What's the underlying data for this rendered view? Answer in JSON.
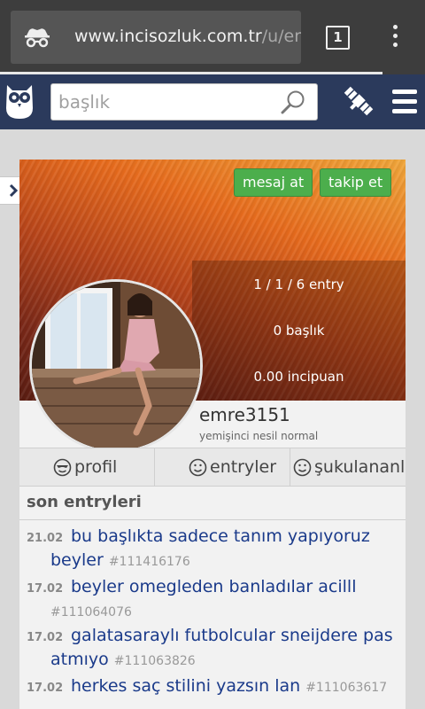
{
  "browser": {
    "url_host": "www.incisozluk.com.tr",
    "url_path": "/u/er",
    "tab_count": "1"
  },
  "header": {
    "search_placeholder": "başlık"
  },
  "profile": {
    "message_button": "mesaj at",
    "follow_button": "takip et",
    "stats": {
      "entries": "1 / 1 / 6 entry",
      "titles": "0 başlık",
      "points": "0.00 incipuan"
    },
    "username": "emre3151",
    "user_type": "yemişinci nesil normal",
    "tabs": [
      "profil",
      "entryler",
      "şukulananlar"
    ]
  },
  "recent_entries": {
    "title": "son entryleri",
    "items": [
      {
        "date": "21.02",
        "text": "bu başlıkta sadece tanım yapıyoruz beyler",
        "id": "#111416176"
      },
      {
        "date": "17.02",
        "text": "beyler omegleden banladılar acilll",
        "id": "#111064076"
      },
      {
        "date": "17.02",
        "text": "galatasaraylı futbolcular sneijdere pas atmıyo",
        "id": "#111063826"
      },
      {
        "date": "17.02",
        "text": "herkes saç stilini yazsın lan",
        "id": "#111063617"
      }
    ]
  },
  "colors": {
    "header_bg": "#2b3a5c",
    "button_green": "#4cae4c",
    "link_blue": "#1a3a8a"
  }
}
